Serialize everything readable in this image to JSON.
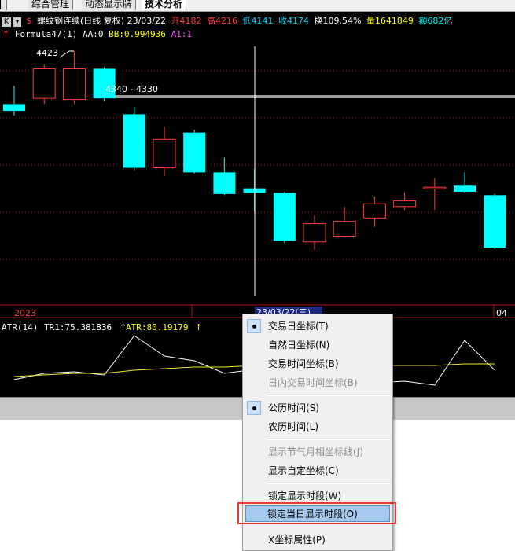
{
  "tabs": [
    {
      "label": "综合管理"
    },
    {
      "label": "动态显示牌"
    },
    {
      "label": "技术分析"
    }
  ],
  "info": {
    "period_btn": "K",
    "title": "螺纹钢连续(日线 复权) 23/03/22",
    "open": "开4182",
    "high": "高4216",
    "low": "低4141",
    "close": "收4174",
    "turnover": "换109.54%",
    "volume": "量1641849",
    "amount": "额682亿"
  },
  "formula": {
    "name": "Formula47(1)",
    "aa": "AA:0",
    "bb": "BB:0.994936",
    "a1": "A1:1"
  },
  "chart_labels": {
    "peak": "4423",
    "range": "4340 - 4330",
    "year": "2023",
    "cursor_date": "23/03/22(三)",
    "month": "04"
  },
  "atr": {
    "name": "ATR(14)",
    "tr1": "TR1:75.381836",
    "atr": "ATR:80.19179"
  },
  "chart_data": {
    "type": "candlestick",
    "candles": [
      {
        "open": 4330,
        "close": 4318,
        "high": 4362,
        "low": 4310
      },
      {
        "open": 4340,
        "close": 4392,
        "high": 4400,
        "low": 4330
      },
      {
        "open": 4338,
        "close": 4392,
        "high": 4423,
        "low": 4330
      },
      {
        "open": 4392,
        "close": 4340,
        "high": 4395,
        "low": 4335
      },
      {
        "open": 4312,
        "close": 4218,
        "high": 4325,
        "low": 4214
      },
      {
        "open": 4218,
        "close": 4268,
        "high": 4290,
        "low": 4204
      },
      {
        "open": 4280,
        "close": 4210,
        "high": 4285,
        "low": 4208
      },
      {
        "open": 4210,
        "close": 4172,
        "high": 4236,
        "low": 4170
      },
      {
        "open": 4182,
        "close": 4174,
        "high": 4216,
        "low": 4141
      },
      {
        "open": 4174,
        "close": 4090,
        "high": 4176,
        "low": 4086
      },
      {
        "open": 4088,
        "close": 4120,
        "high": 4135,
        "low": 4074
      },
      {
        "open": 4098,
        "close": 4124,
        "high": 4150,
        "low": 4096
      },
      {
        "open": 4130,
        "close": 4155,
        "high": 4168,
        "low": 4114
      },
      {
        "open": 4150,
        "close": 4160,
        "high": 4175,
        "low": 4144
      },
      {
        "open": 4182,
        "close": 4184,
        "high": 4200,
        "low": 4144
      },
      {
        "open": 4188,
        "close": 4176,
        "high": 4210,
        "low": 4174
      },
      {
        "open": 4170,
        "close": 4078,
        "high": 4172,
        "low": 4076
      }
    ],
    "atr_tr1": [
      62,
      70,
      72,
      68,
      118,
      92,
      86,
      70,
      75,
      96,
      70,
      64,
      58,
      60,
      55,
      112,
      74
    ],
    "atr_line": [
      66,
      68,
      70,
      70,
      74,
      76,
      78,
      78,
      80,
      80,
      80,
      80,
      80,
      80,
      80,
      82,
      82
    ]
  },
  "menu": {
    "items": [
      {
        "label": "交易日坐标(T)",
        "checked": true,
        "disabled": false
      },
      {
        "label": "自然日坐标(N)",
        "checked": false,
        "disabled": false
      },
      {
        "label": "交易时间坐标(B)",
        "checked": false,
        "disabled": false
      },
      {
        "label": "日内交易时间坐标(B)",
        "checked": false,
        "disabled": true
      },
      {
        "label": "公历时间(S)",
        "checked": true,
        "disabled": false
      },
      {
        "label": "农历时间(L)",
        "checked": false,
        "disabled": false
      },
      {
        "label": "显示节气月相坐标线(J)",
        "checked": false,
        "disabled": true
      },
      {
        "label": "显示自定坐标(C)",
        "checked": false,
        "disabled": false
      },
      {
        "label": "锁定显示时段(W)",
        "checked": false,
        "disabled": false
      },
      {
        "label": "锁定当日显示时段(O)",
        "checked": false,
        "disabled": false,
        "highlighted": true
      },
      {
        "label": "X坐标属性(P)",
        "checked": false,
        "disabled": false
      }
    ]
  },
  "colors": {
    "up": "#ff3b3b",
    "down": "#00ffff",
    "grid": "#9b1b1b",
    "tr1_line": "#ffffff",
    "atr_line": "#e8e830",
    "label_yellow": "#ffff00",
    "label_magenta": "#ff55ff"
  }
}
